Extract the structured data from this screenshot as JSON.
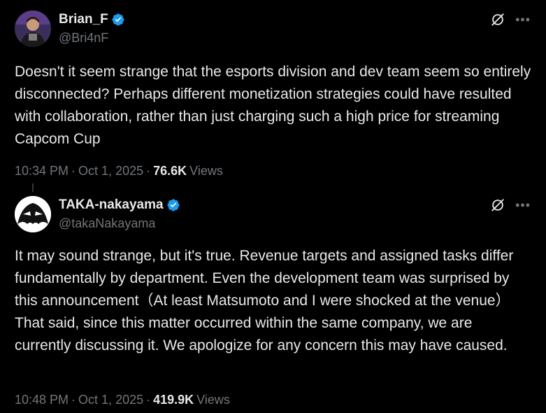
{
  "posts": [
    {
      "author_name": "Brian_F",
      "handle": "@Bri4nF",
      "verified": true,
      "text": "Doesn't it seem strange that the esports division and dev team seem so entirely disconnected? Perhaps different monetization strategies could have resulted with collaboration, rather than just charging such a high price for streaming Capcom Cup",
      "time": "10:34 PM",
      "date": "Oct 1, 2025",
      "views_count": "76.6K",
      "views_label": "Views"
    },
    {
      "author_name": "TAKA-nakayama",
      "handle": "@takaNakayama",
      "verified": true,
      "text": "It may sound strange, but it's true. Revenue targets and assigned tasks differ fundamentally by department. Even the development team was surprised by this announcement（At least Matsumoto and I were shocked at the venue）That said, since this matter occurred within the same company, we are currently discussing it. We apologize for any concern this may have caused.",
      "time": "10:48 PM",
      "date": "Oct 1, 2025",
      "views_count": "419.9K",
      "views_label": "Views"
    }
  ],
  "separator": "·",
  "icons": {
    "verified": "verified-badge-icon",
    "grok": "grok-icon",
    "more": "more-icon"
  },
  "colors": {
    "background": "#000000",
    "text": "#e7e9ea",
    "secondary": "#71767b",
    "verified": "#1d9bf0"
  }
}
